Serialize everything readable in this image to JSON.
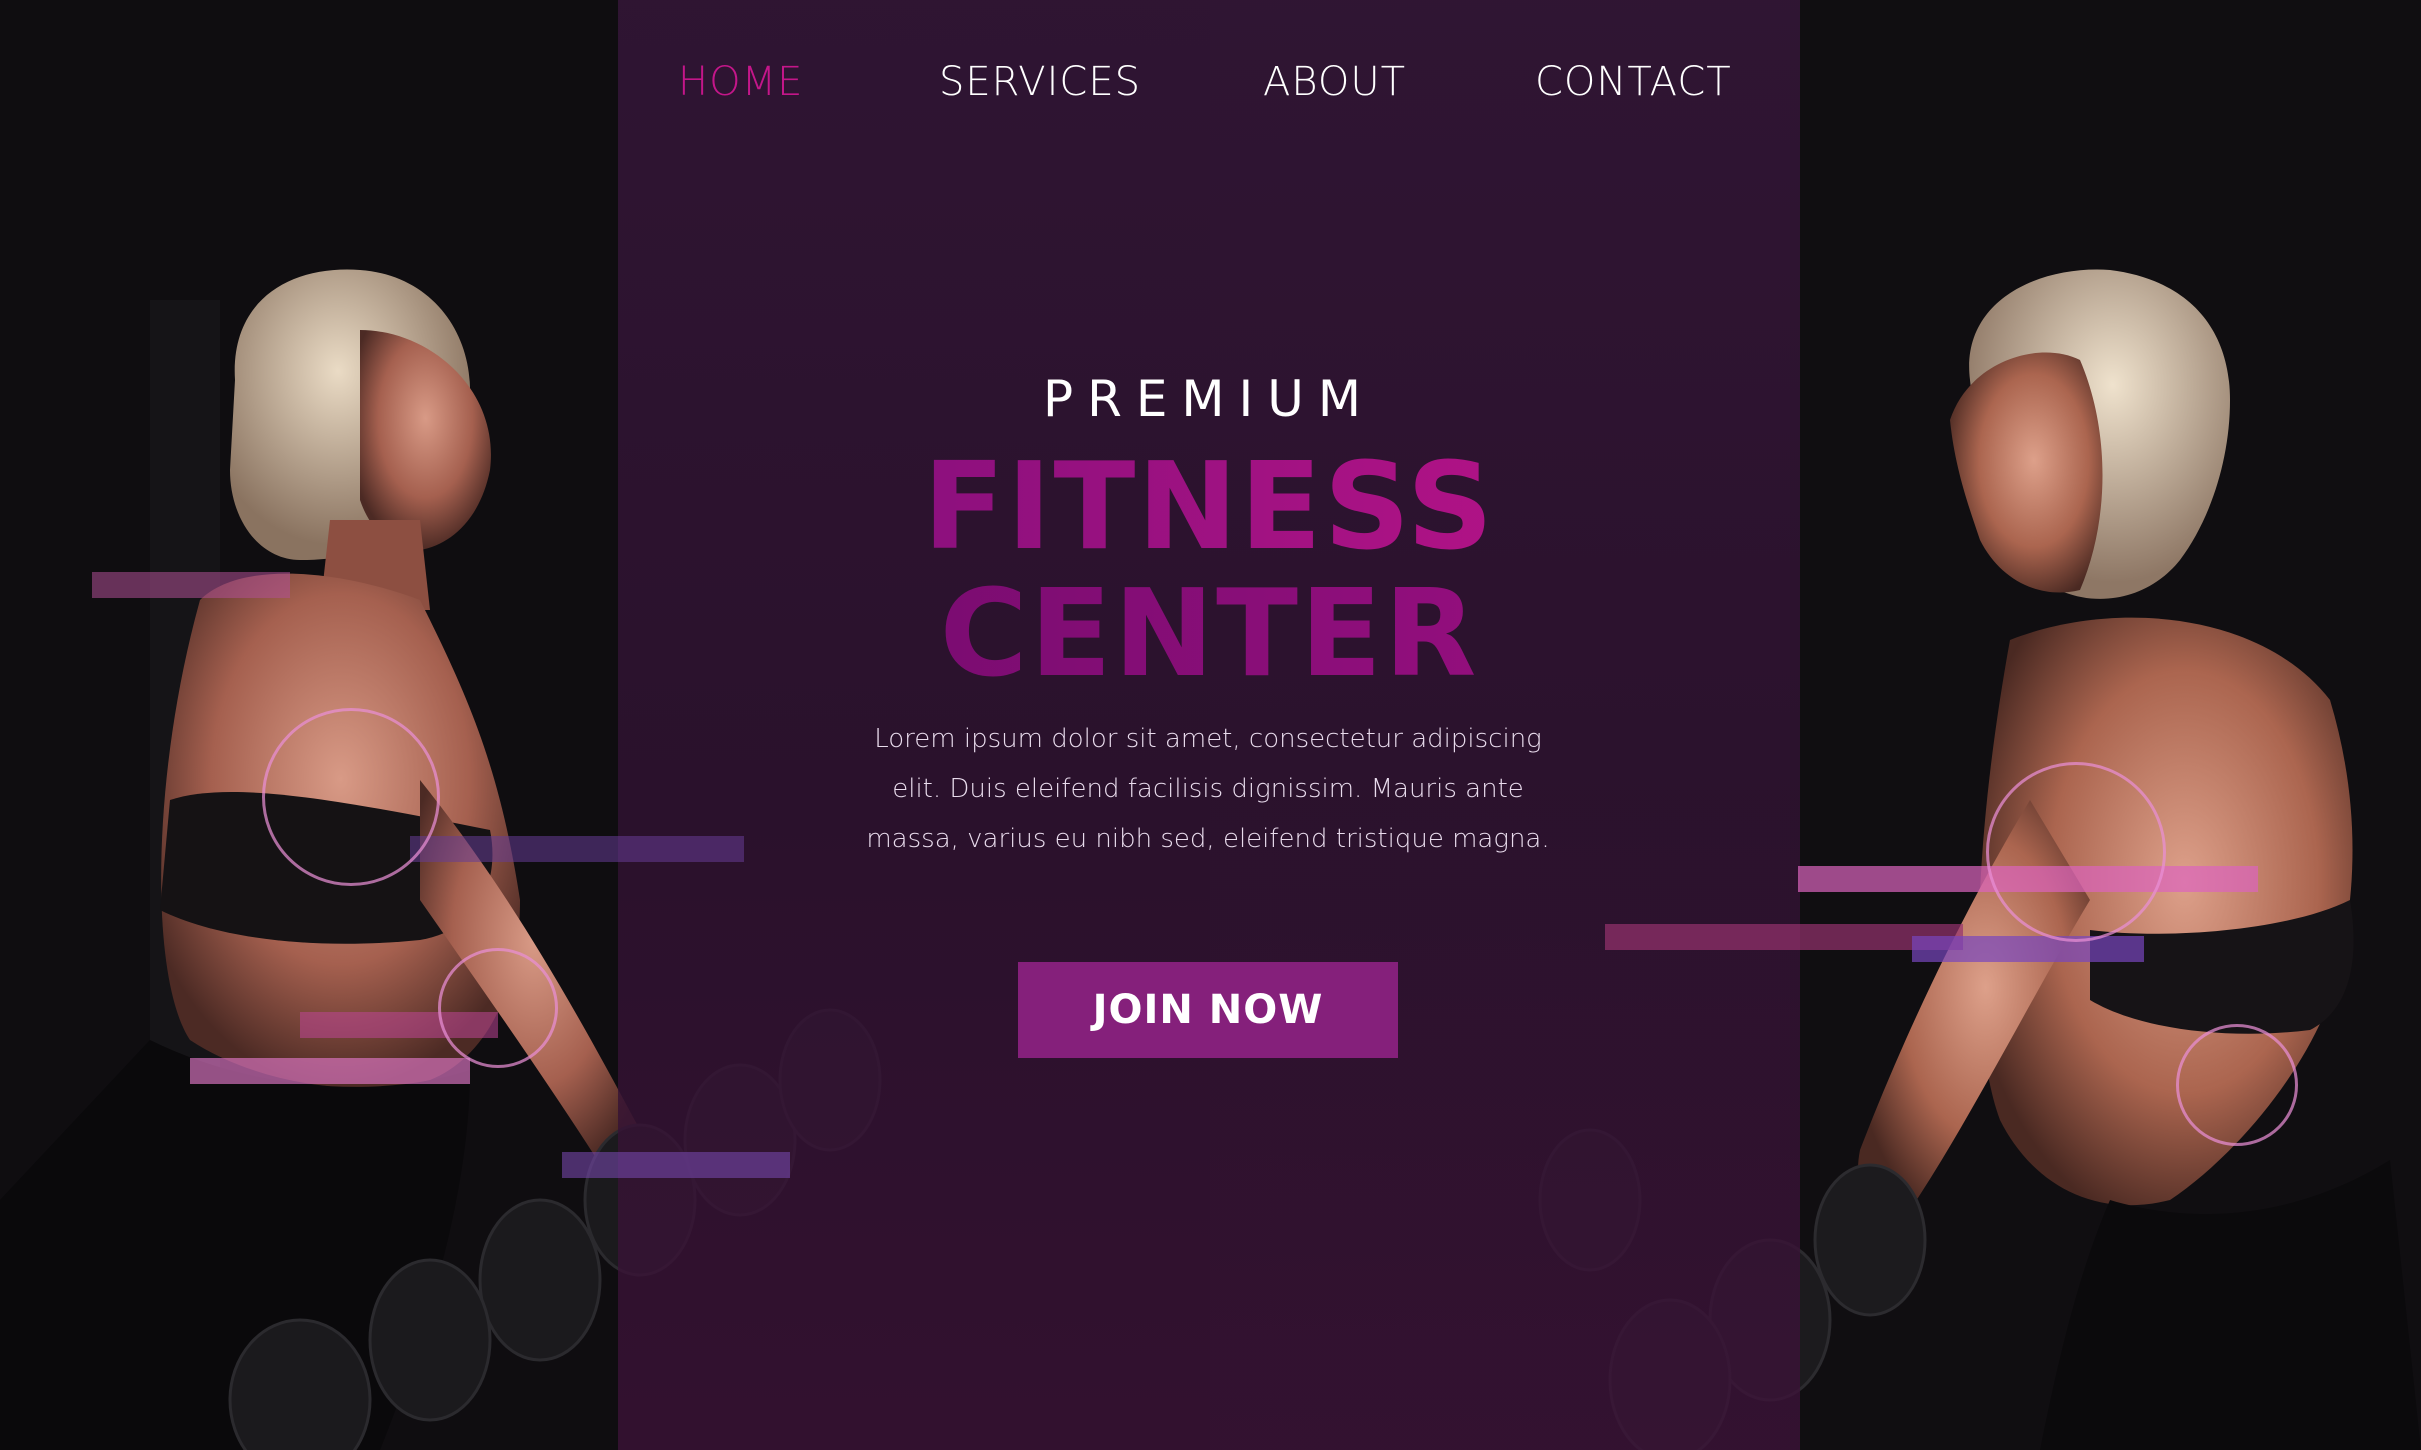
{
  "nav": {
    "items": [
      {
        "label": "HOME",
        "active": true
      },
      {
        "label": "SERVICES",
        "active": false
      },
      {
        "label": "ABOUT",
        "active": false
      },
      {
        "label": "CONTACT",
        "active": false
      }
    ]
  },
  "hero": {
    "kicker": "PREMIUM",
    "title_line1": "FITNESS",
    "title_line2": "CENTER",
    "body": "Lorem ipsum dolor sit amet, consectetur adipiscing elit. Duis eleifend facilisis dignissim. Mauris ante massa, varius eu nibh sed, eleifend tristique magna.",
    "cta_label": "JOIN NOW"
  },
  "colors": {
    "accent": "#c4168a",
    "panel": "#341638",
    "button": "#85207b",
    "text_light": "#ffffff"
  }
}
